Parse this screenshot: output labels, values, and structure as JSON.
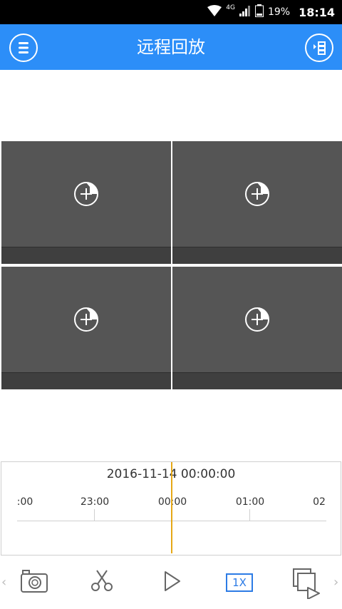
{
  "status_bar": {
    "network": "4G",
    "battery_percent": "19%",
    "time": "18:14"
  },
  "header": {
    "title": "远程回放"
  },
  "playback_cells": [
    {
      "icon": "add-channel-icon"
    },
    {
      "icon": "add-channel-icon"
    },
    {
      "icon": "add-channel-icon"
    },
    {
      "icon": "add-channel-icon"
    }
  ],
  "timeline": {
    "datetime": "2016-11-14 00:00:00",
    "ticks": [
      ":00",
      "23:00",
      "00:00",
      "01:00",
      "02"
    ]
  },
  "toolbar": {
    "speed_label": "1X"
  },
  "colors": {
    "accent": "#2c8ef8",
    "cursor": "#e6a817",
    "cell_bg": "#555555"
  }
}
